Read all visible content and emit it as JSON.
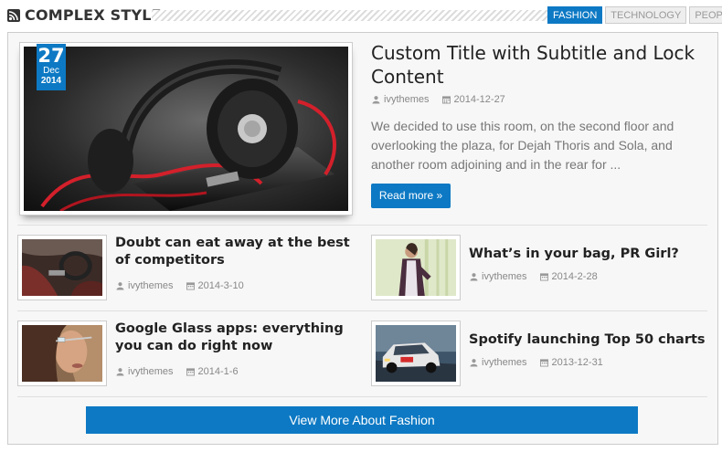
{
  "header": {
    "title": "COMPLEX STYLE",
    "tabs": [
      "FASHION",
      "TECHNOLOGY",
      "PEOPLE"
    ],
    "active_tab": "FASHION",
    "icon": "rss-icon"
  },
  "featured": {
    "date": {
      "day": "27",
      "month": "Dec",
      "year": "2014"
    },
    "title": "Custom Title with Subtitle and Lock Content",
    "author": "ivythemes",
    "date_text": "2014-12-27",
    "excerpt": "We decided to use this room, on the second floor and overlooking the plaza, for Dejah Thoris and Sola, and another room adjoining and in the rear for ...",
    "read_more": "Read more »",
    "image": "headphones-on-phone"
  },
  "posts": [
    {
      "title": "Doubt can eat away at the best of competitors",
      "author": "ivythemes",
      "date": "2014-3-10",
      "image": "car-interior"
    },
    {
      "title": "What’s in your bag, PR Girl?",
      "author": "ivythemes",
      "date": "2014-2-28",
      "image": "fashion-girl"
    },
    {
      "title": "Google Glass apps: everything you can do right now",
      "author": "ivythemes",
      "date": "2014-1-6",
      "image": "woman-with-glass"
    },
    {
      "title": "Spotify launching Top 50 charts",
      "author": "ivythemes",
      "date": "2013-12-31",
      "image": "rally-car"
    }
  ],
  "view_more": "View More About Fashion",
  "colors": {
    "accent": "#0d79c4",
    "muted": "#888888",
    "title": "#222222"
  }
}
